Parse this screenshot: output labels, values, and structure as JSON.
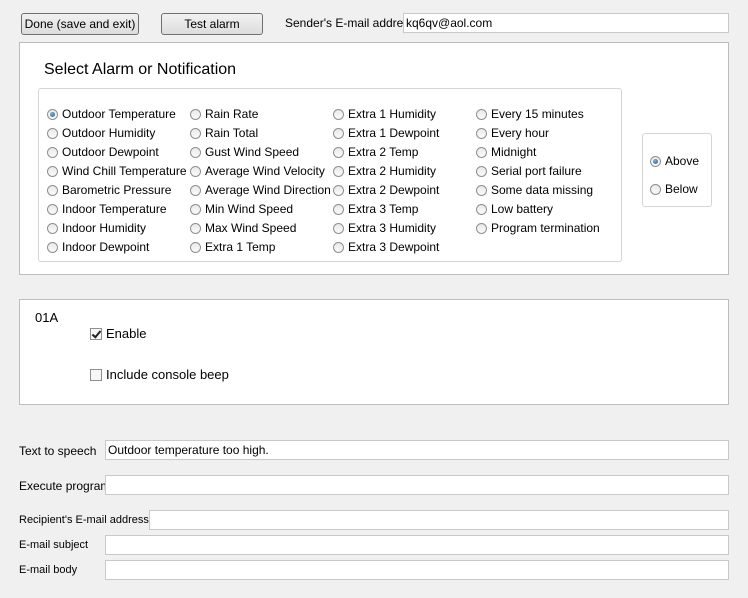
{
  "toolbar": {
    "done_label": "Done (save and exit)",
    "test_label": "Test alarm",
    "sender_label": "Sender's E-mail address:",
    "sender_value": "kq6qv@aol.com"
  },
  "select_panel": {
    "title": "Select Alarm or Notification",
    "options": [
      [
        "Outdoor Temperature",
        "Outdoor Humidity",
        "Outdoor Dewpoint",
        "Wind Chill Temperature",
        "Barometric Pressure",
        "Indoor Temperature",
        "Indoor Humidity",
        "Indoor Dewpoint"
      ],
      [
        "Rain Rate",
        "Rain Total",
        "Gust Wind Speed",
        "Average Wind Velocity",
        "Average Wind Direction",
        "Min Wind Speed",
        "Max Wind Speed",
        "Extra 1 Temp"
      ],
      [
        "Extra 1 Humidity",
        "Extra 1 Dewpoint",
        "Extra 2 Temp",
        "Extra 2 Humidity",
        "Extra 2 Dewpoint",
        "Extra 3 Temp",
        "Extra 3 Humidity",
        "Extra 3 Dewpoint"
      ],
      [
        "Every 15 minutes",
        "Every hour",
        "Midnight",
        "Serial port failure",
        "Some data missing",
        "Low battery",
        "Program termination"
      ]
    ],
    "selected": "Outdoor Temperature",
    "threshold": {
      "above_label": "Above",
      "below_label": "Below",
      "selected": "Above"
    }
  },
  "alarm_panel": {
    "code": "01A",
    "enable_label": "Enable",
    "enable_checked": true,
    "beep_label": "Include console beep",
    "beep_checked": false
  },
  "fields": {
    "speech_label": "Text to speech",
    "speech_value": "Outdoor temperature too high.",
    "program_label": "Execute program",
    "program_value": "",
    "recipient_label": "Recipient's E-mail address",
    "recipient_value": "",
    "subject_label": "E-mail subject",
    "subject_value": "",
    "body_label": "E-mail body",
    "body_value": ""
  }
}
